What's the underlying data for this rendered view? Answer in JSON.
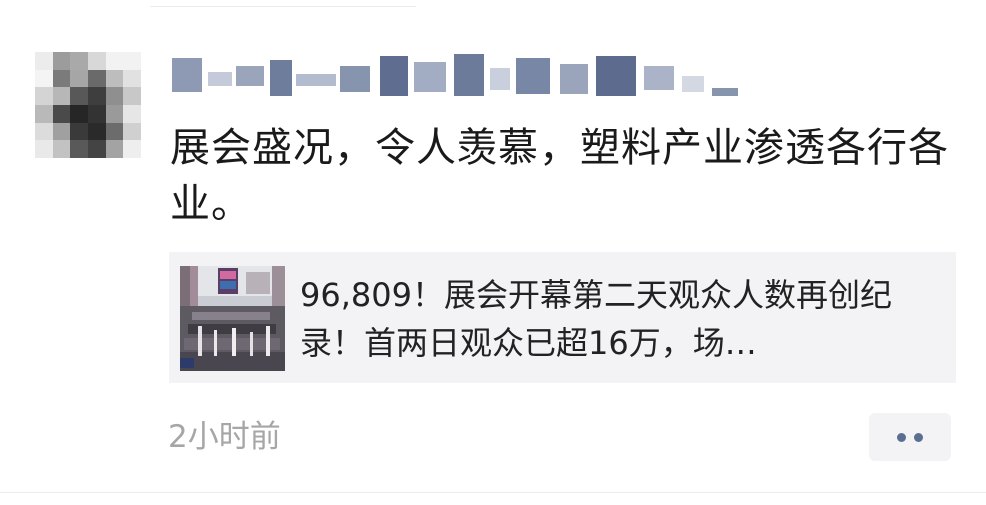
{
  "post": {
    "text": "展会盛况，令人羡慕，塑料产业渗透各行各业。",
    "timestamp": "2小时前"
  },
  "shared_article": {
    "title": "96,809！展会开幕第二天观众人数再创纪录！首两日观众已超16万，场…"
  },
  "icons": {
    "more": "more-dots-icon"
  },
  "colors": {
    "post_text": "#1a1a1a",
    "timestamp": "#a6a6a6",
    "card_background": "#f3f3f5",
    "more_dots": "#5b6e92"
  }
}
